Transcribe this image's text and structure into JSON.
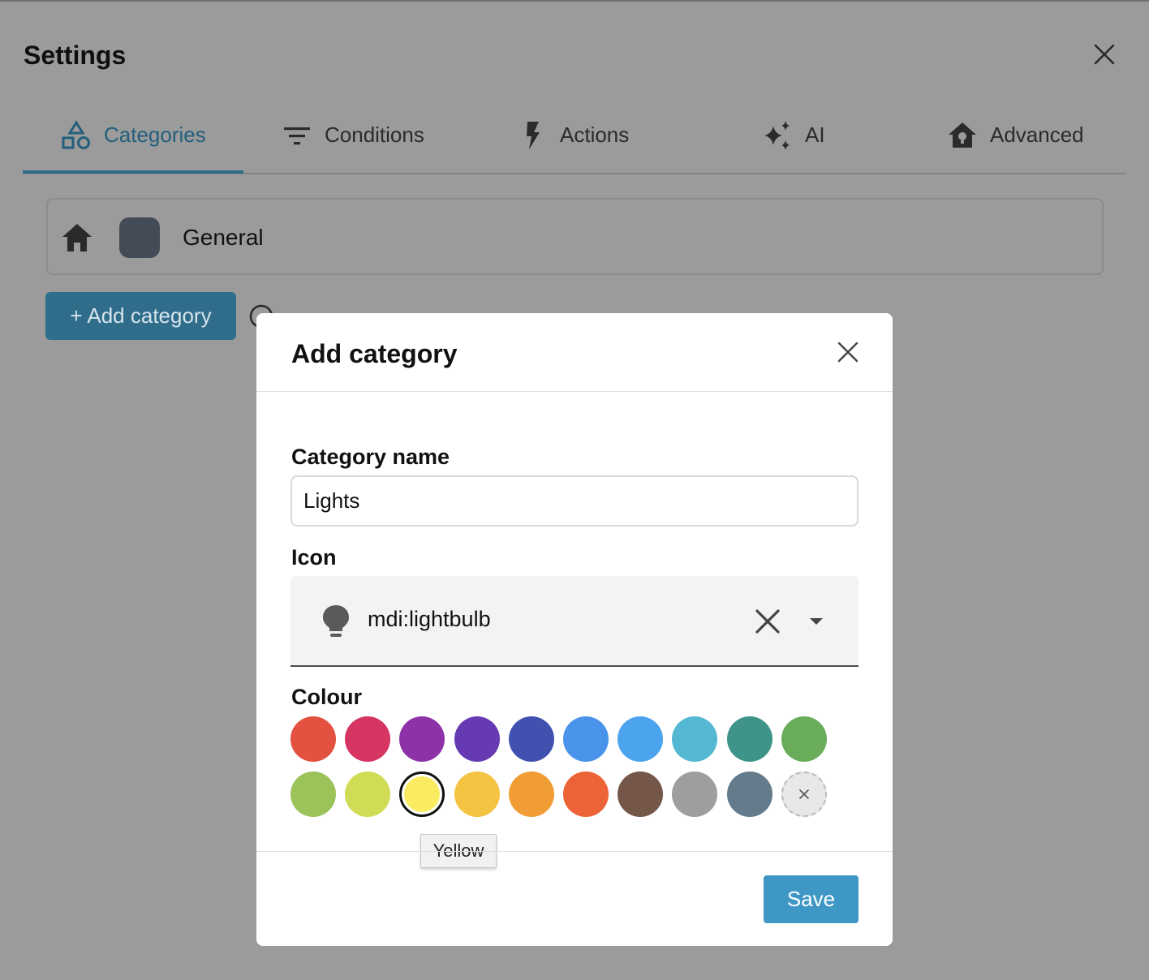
{
  "settings": {
    "title": "Settings",
    "tabs": [
      {
        "label": "Categories",
        "icon": "shapes-icon",
        "active": true
      },
      {
        "label": "Conditions",
        "icon": "filter-icon",
        "active": false
      },
      {
        "label": "Actions",
        "icon": "lightning-bolt-icon",
        "active": false
      },
      {
        "label": "AI",
        "icon": "sparkles-icon",
        "active": false
      },
      {
        "label": "Advanced",
        "icon": "home-lightbulb-icon",
        "active": false
      }
    ],
    "categories": [
      {
        "name": "General",
        "icon": "home-icon",
        "color": "#434c56"
      }
    ],
    "add_category_label": "+ Add category"
  },
  "dialog": {
    "title": "Add category",
    "name_label": "Category name",
    "name_value": "Lights",
    "icon_label": "Icon",
    "icon_value": "mdi:lightbulb",
    "colour_label": "Colour",
    "colours": [
      "#e35140",
      "#d63562",
      "#8e32a8",
      "#653ab2",
      "#4251b0",
      "#4a93ea",
      "#4ba4ed",
      "#55b8d2",
      "#3f948a",
      "#69ad5a",
      "#9cc35a",
      "#d0dc56",
      "#fbeb60",
      "#f5c342",
      "#f19d36",
      "#ec6337",
      "#755749",
      "#9e9e9e",
      "#647b8b"
    ],
    "selected_colour_index": 12,
    "tooltip": "Yellow",
    "save_label": "Save"
  }
}
